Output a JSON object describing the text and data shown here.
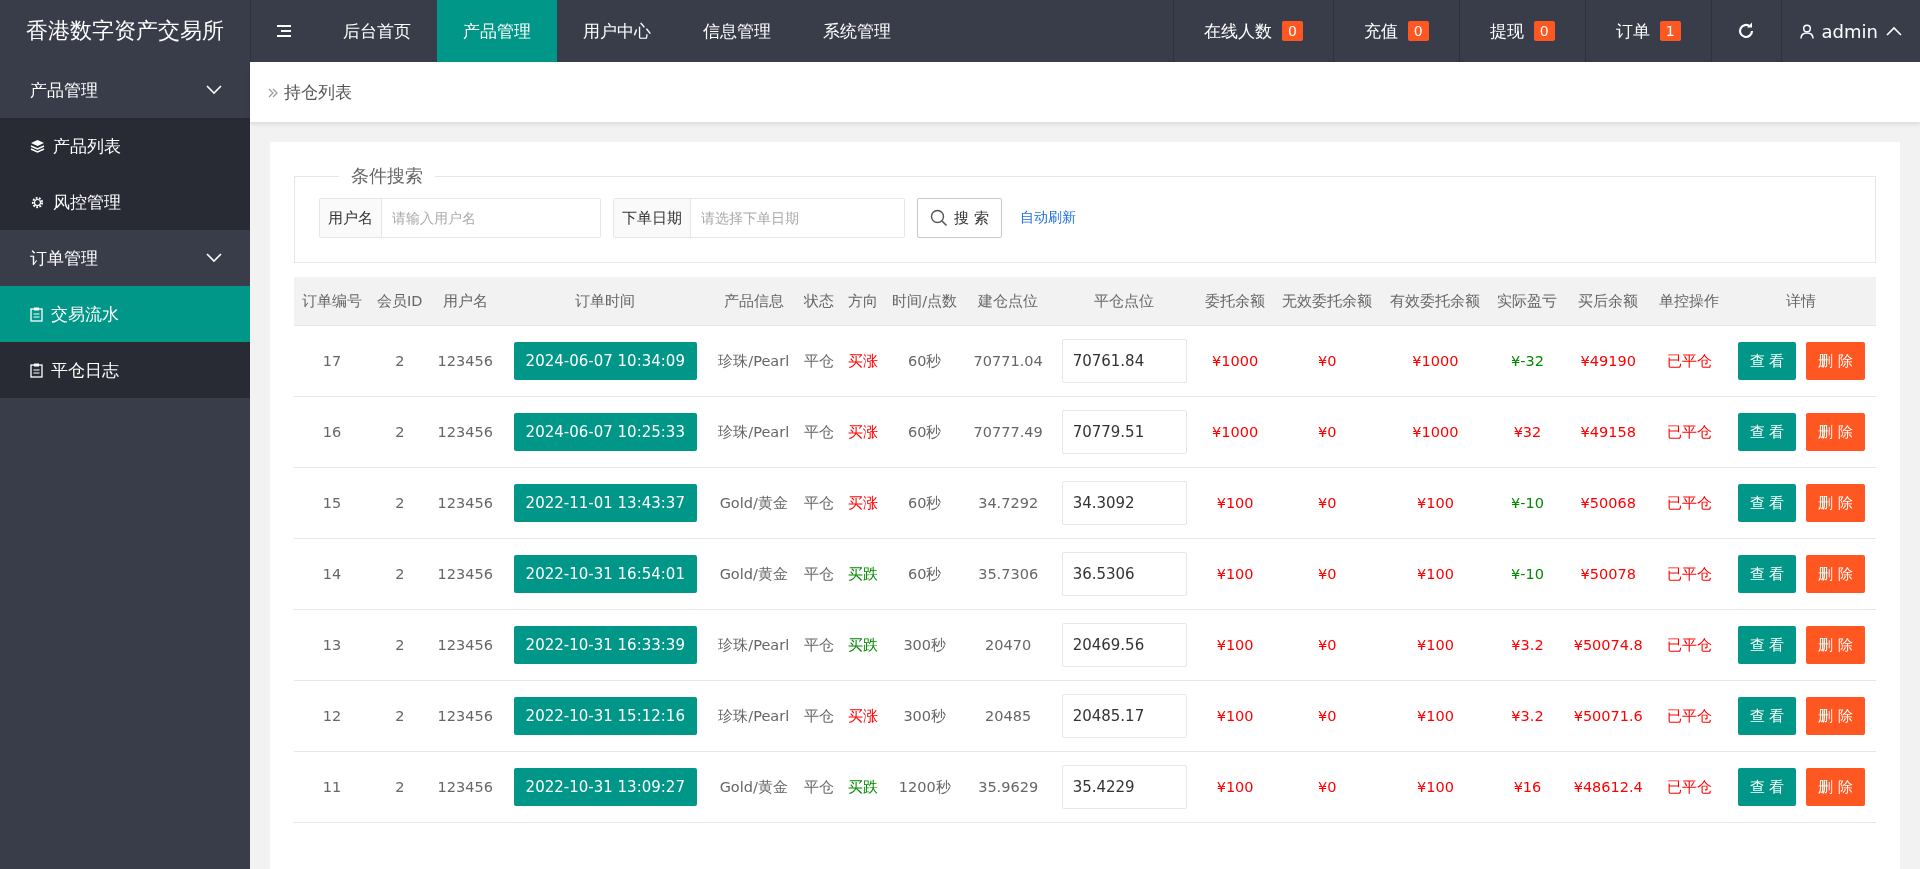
{
  "app": {
    "title": "香港数字资产交易所"
  },
  "nav_tabs": [
    {
      "label": "后台首页",
      "selected": false
    },
    {
      "label": "产品管理",
      "selected": true
    },
    {
      "label": "用户中心",
      "selected": false
    },
    {
      "label": "信息管理",
      "selected": false
    },
    {
      "label": "系统管理",
      "selected": false
    }
  ],
  "stats": [
    {
      "label": "在线人数",
      "count": "0"
    },
    {
      "label": "充值",
      "count": "0"
    },
    {
      "label": "提现",
      "count": "0"
    },
    {
      "label": "订单",
      "count": "1"
    }
  ],
  "user": {
    "name": "admin"
  },
  "sidebar": [
    {
      "label": "产品管理",
      "expanded": true,
      "children": [
        {
          "label": "产品列表",
          "selected": false
        },
        {
          "label": "风控管理",
          "selected": false
        }
      ]
    },
    {
      "label": "订单管理",
      "expanded": true,
      "children": [
        {
          "label": "交易流水",
          "selected": true
        },
        {
          "label": "平仓日志",
          "selected": false
        }
      ]
    }
  ],
  "breadcrumb": "持仓列表",
  "search": {
    "legend": "条件搜索",
    "fields": [
      {
        "label": "用户名",
        "placeholder": "请输入用户名"
      },
      {
        "label": "下单日期",
        "placeholder": "请选择下单日期"
      }
    ],
    "button": "搜 索",
    "link": "自动刷新"
  },
  "table": {
    "columns": [
      "订单编号",
      "会员ID",
      "用户名",
      "订单时间",
      "产品信息",
      "状态",
      "方向",
      "时间/点数",
      "建仓点位",
      "平仓点位",
      "委托余额",
      "无效委托余额",
      "有效委托余额",
      "实际盈亏",
      "买后余额",
      "单控操作",
      "详情"
    ],
    "rows": [
      {
        "id": "17",
        "member_id": "2",
        "username": "123456",
        "time": "2024-06-07 10:34:09",
        "product": "珍珠/Pearl",
        "status": "平仓",
        "direction": {
          "text": "买涨",
          "kind": "rise"
        },
        "duration": "60秒",
        "open_price": "70771.04",
        "close_price": "70761.84",
        "amount": "¥1000",
        "invalid_amount": "¥0",
        "valid_amount": "¥1000",
        "pnl": {
          "text": "¥-32",
          "kind": "loss"
        },
        "balance": "¥49190",
        "control": "已平仓",
        "actions": [
          "查 看",
          "删 除"
        ]
      },
      {
        "id": "16",
        "member_id": "2",
        "username": "123456",
        "time": "2024-06-07 10:25:33",
        "product": "珍珠/Pearl",
        "status": "平仓",
        "direction": {
          "text": "买涨",
          "kind": "rise"
        },
        "duration": "60秒",
        "open_price": "70777.49",
        "close_price": "70779.51",
        "amount": "¥1000",
        "invalid_amount": "¥0",
        "valid_amount": "¥1000",
        "pnl": {
          "text": "¥32",
          "kind": "gain"
        },
        "balance": "¥49158",
        "control": "已平仓",
        "actions": [
          "查 看",
          "删 除"
        ]
      },
      {
        "id": "15",
        "member_id": "2",
        "username": "123456",
        "time": "2022-11-01 13:43:37",
        "product": "Gold/黄金",
        "status": "平仓",
        "direction": {
          "text": "买涨",
          "kind": "rise"
        },
        "duration": "60秒",
        "open_price": "34.7292",
        "close_price": "34.3092",
        "amount": "¥100",
        "invalid_amount": "¥0",
        "valid_amount": "¥100",
        "pnl": {
          "text": "¥-10",
          "kind": "loss"
        },
        "balance": "¥50068",
        "control": "已平仓",
        "actions": [
          "查 看",
          "删 除"
        ]
      },
      {
        "id": "14",
        "member_id": "2",
        "username": "123456",
        "time": "2022-10-31 16:54:01",
        "product": "Gold/黄金",
        "status": "平仓",
        "direction": {
          "text": "买跌",
          "kind": "fall"
        },
        "duration": "60秒",
        "open_price": "35.7306",
        "close_price": "36.5306",
        "amount": "¥100",
        "invalid_amount": "¥0",
        "valid_amount": "¥100",
        "pnl": {
          "text": "¥-10",
          "kind": "loss"
        },
        "balance": "¥50078",
        "control": "已平仓",
        "actions": [
          "查 看",
          "删 除"
        ]
      },
      {
        "id": "13",
        "member_id": "2",
        "username": "123456",
        "time": "2022-10-31 16:33:39",
        "product": "珍珠/Pearl",
        "status": "平仓",
        "direction": {
          "text": "买跌",
          "kind": "fall"
        },
        "duration": "300秒",
        "open_price": "20470",
        "close_price": "20469.56",
        "amount": "¥100",
        "invalid_amount": "¥0",
        "valid_amount": "¥100",
        "pnl": {
          "text": "¥3.2",
          "kind": "gain"
        },
        "balance": "¥50074.8",
        "control": "已平仓",
        "actions": [
          "查 看",
          "删 除"
        ]
      },
      {
        "id": "12",
        "member_id": "2",
        "username": "123456",
        "time": "2022-10-31 15:12:16",
        "product": "珍珠/Pearl",
        "status": "平仓",
        "direction": {
          "text": "买涨",
          "kind": "rise"
        },
        "duration": "300秒",
        "open_price": "20485",
        "close_price": "20485.17",
        "amount": "¥100",
        "invalid_amount": "¥0",
        "valid_amount": "¥100",
        "pnl": {
          "text": "¥3.2",
          "kind": "gain"
        },
        "balance": "¥50071.6",
        "control": "已平仓",
        "actions": [
          "查 看",
          "删 除"
        ]
      },
      {
        "id": "11",
        "member_id": "2",
        "username": "123456",
        "time": "2022-10-31 13:09:27",
        "product": "Gold/黄金",
        "status": "平仓",
        "direction": {
          "text": "买跌",
          "kind": "fall"
        },
        "duration": "1200秒",
        "open_price": "35.9629",
        "close_price": "35.4229",
        "amount": "¥100",
        "invalid_amount": "¥0",
        "valid_amount": "¥100",
        "pnl": {
          "text": "¥16",
          "kind": "gain"
        },
        "balance": "¥48612.4",
        "control": "已平仓",
        "actions": [
          "查 看",
          "删 除"
        ]
      }
    ]
  }
}
